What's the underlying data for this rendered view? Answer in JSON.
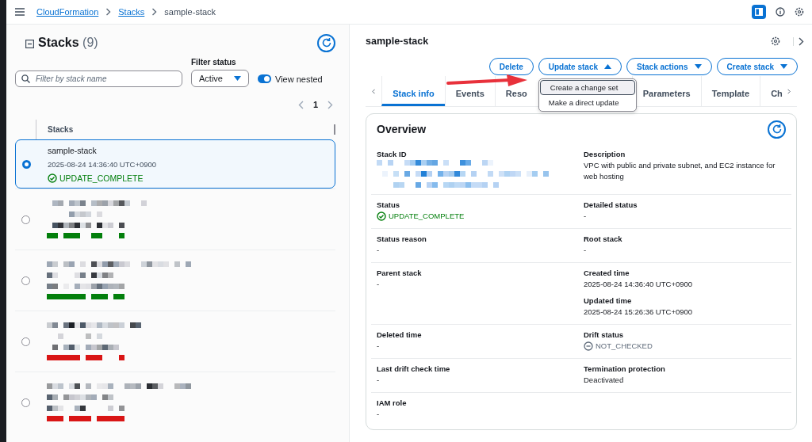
{
  "top_bar": {
    "breadcrumbs": [
      {
        "label": "CloudFormation",
        "kind": "link"
      },
      {
        "label": "Stacks",
        "kind": "link"
      },
      {
        "label": "sample-stack",
        "kind": "current"
      }
    ]
  },
  "stacks_panel": {
    "title": "Stacks",
    "count": "(9)",
    "search": {
      "placeholder": "Filter by stack name"
    },
    "filter_status": {
      "label": "Filter status",
      "value": "Active"
    },
    "view_nested": {
      "label": "View nested",
      "on": true
    },
    "page": "1",
    "column": "Stacks",
    "rows": [
      {
        "kind": "stack",
        "selected": true,
        "name": "sample-stack",
        "time": "2025-08-24 14:36:40 UTC+0900",
        "status": "UPDATE_COMPLETE",
        "color": "#037f0c"
      },
      {
        "kind": "redacted",
        "selected": false,
        "color": "#037f0c"
      },
      {
        "kind": "redacted",
        "selected": false,
        "color": "#037f0c"
      },
      {
        "kind": "redacted",
        "selected": false,
        "color": "#d91515"
      },
      {
        "kind": "redacted",
        "selected": false,
        "color": "#d91515"
      }
    ]
  },
  "detail": {
    "title": "sample-stack",
    "buttons": [
      {
        "label": "Delete",
        "kind": "plain"
      },
      {
        "label": "Update stack",
        "kind": "menu",
        "expanded": true
      },
      {
        "label": "Stack actions",
        "kind": "menu",
        "expanded": false
      },
      {
        "label": "Create stack",
        "kind": "menu",
        "expanded": false
      }
    ],
    "menu": [
      {
        "label": "Create a change set",
        "selected": true
      },
      {
        "label": "Make a direct update",
        "selected": false
      }
    ],
    "tabs": [
      {
        "label": "Stack info",
        "selected": true
      },
      {
        "label": "Events",
        "selected": false
      },
      {
        "label": "Reso",
        "selected": false
      },
      {
        "label": "Parameters",
        "selected": false
      },
      {
        "label": "Template",
        "selected": false
      },
      {
        "label": "Ch",
        "selected": false
      }
    ],
    "overview": {
      "title": "Overview",
      "rows": [
        {
          "left": [
            {
              "label": "Stack ID",
              "kind": "redacted"
            }
          ],
          "right": [
            {
              "label": "Description",
              "kind": "text",
              "value": "VPC with public and private subnet, and EC2 instance for web hosting"
            }
          ]
        },
        {
          "left": [
            {
              "label": "Status",
              "kind": "success_status",
              "value": "UPDATE_COMPLETE"
            }
          ],
          "right": [
            {
              "label": "Detailed status",
              "kind": "text",
              "value": "-"
            }
          ]
        },
        {
          "left": [
            {
              "label": "Status reason",
              "kind": "text",
              "value": "-"
            }
          ],
          "right": [
            {
              "label": "Root stack",
              "kind": "text",
              "value": "-"
            }
          ]
        },
        {
          "left": [
            {
              "label": "Parent stack",
              "kind": "text",
              "value": "-"
            }
          ],
          "right": [
            {
              "label": "Created time",
              "kind": "text",
              "value": "2025-08-24 14:36:40 UTC+0900"
            },
            {
              "label": "Updated time",
              "kind": "text",
              "value": "2025-08-24 15:26:36 UTC+0900"
            }
          ]
        },
        {
          "left": [
            {
              "label": "Deleted time",
              "kind": "text",
              "value": "-"
            }
          ],
          "right": [
            {
              "label": "Drift status",
              "kind": "unchecked_status",
              "value": "NOT_CHECKED"
            }
          ]
        },
        {
          "left": [
            {
              "label": "Last drift check time",
              "kind": "text",
              "value": "-"
            }
          ],
          "right": [
            {
              "label": "Termination protection",
              "kind": "text",
              "value": "Deactivated"
            }
          ]
        },
        {
          "left": [
            {
              "label": "IAM role",
              "kind": "text",
              "value": "-"
            }
          ],
          "right": []
        }
      ]
    }
  }
}
